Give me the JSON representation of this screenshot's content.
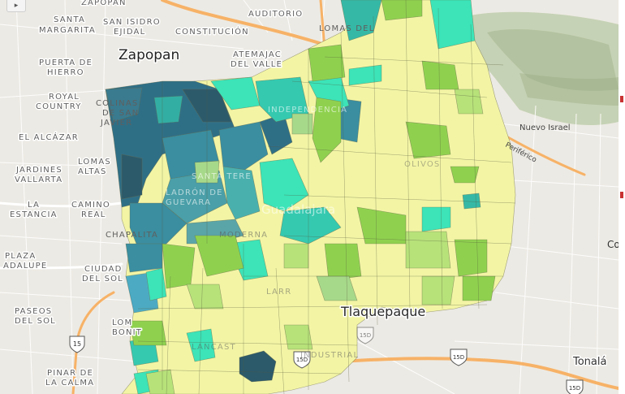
{
  "map": {
    "labels": {
      "zapopan": "Zapopan",
      "guadalajara": "Guadalajara",
      "tlaquepaque": "Tlaquepaque",
      "tonala": "Tonalá",
      "santa_margarita": "SANTA",
      "santa_margarita_2": "MARGARITA",
      "san_isidro": "SAN ISIDRO",
      "san_isidro_2": "EJIDAL",
      "constitucion": "CONSTITUCIÓN",
      "auditorio": "AUDITORIO",
      "zapopan_top": "ZAPOPAN",
      "lomas_del": "LOMAS DEL",
      "atemajac": "ATEMAJAC",
      "atemajac_2": "DEL VALLE",
      "puerta_de_hierro": "PUERTA DE",
      "puerta_de_hierro_2": "HIERRO",
      "royal_country": "ROYAL",
      "royal_country_2": "COUNTRY",
      "colinas": "COLINAS",
      "colinas_2": "DE SAN",
      "colinas_3": "JAVIER",
      "el_alcazar": "EL ALCÁZAR",
      "jardines": "JARDINES",
      "jardines_2": "VALLARTA",
      "lomas_altas": "LOMAS",
      "lomas_altas_2": "ALTAS",
      "la_estancia": "LA",
      "la_estancia_2": "ESTANCIA",
      "camino_real": "CAMINO",
      "camino_real_2": "REAL",
      "chapalita": "CHAPALITA",
      "plaza": "PLAZA",
      "plaza_2": "ADALUPE",
      "ciudad_del_sol": "CIUDAD",
      "ciudad_del_sol_2": "DEL SOL",
      "paseos_del_sol": "PASEOS",
      "paseos_del_sol_2": "DEL SOL",
      "lomas_bonita": "LOM",
      "lomas_bonita_2": "BONIT",
      "pinar": "PINAR DE",
      "pinar_2": "LA CALMA",
      "nuevo_israel": "Nuevo Israel",
      "periferico": "Periférico",
      "independencia": "INDEPENDENCIA",
      "santa_tere": "SANTA TERE",
      "moderna": "MODERNA",
      "olivos": "OLIVOS",
      "lancaster": "LANCAST",
      "industrial": "INDUSTRIAL",
      "ladron": "LADRÓN DE",
      "ladron_2": "GUEVARA",
      "larr": "LARR",
      "co": "Co"
    },
    "highway_shields": [
      {
        "label": "15",
        "id": "shield-15"
      },
      {
        "label": "15D",
        "id": "shield-15d-a"
      },
      {
        "label": "15D",
        "id": "shield-15d-b"
      },
      {
        "label": "15D",
        "id": "shield-15d-c"
      },
      {
        "label": "15D",
        "id": "shield-15d-d"
      }
    ],
    "choropleth_colors": {
      "darkest": "#2c5a6b",
      "dark": "#2f6f86",
      "mid_dark": "#3a8ea0",
      "teal": "#35b9a6",
      "aqua": "#3ce4b8",
      "green": "#8fd14f",
      "light_green": "#b7e27a",
      "yellow": "#f3f5a5",
      "pale": "#f7f8c4"
    },
    "basemap_colors": {
      "land": "#eceae4",
      "major_road": "#f7b267",
      "hills": "#b9c9a5"
    }
  },
  "controls": {
    "toggle_icon": "▸"
  }
}
